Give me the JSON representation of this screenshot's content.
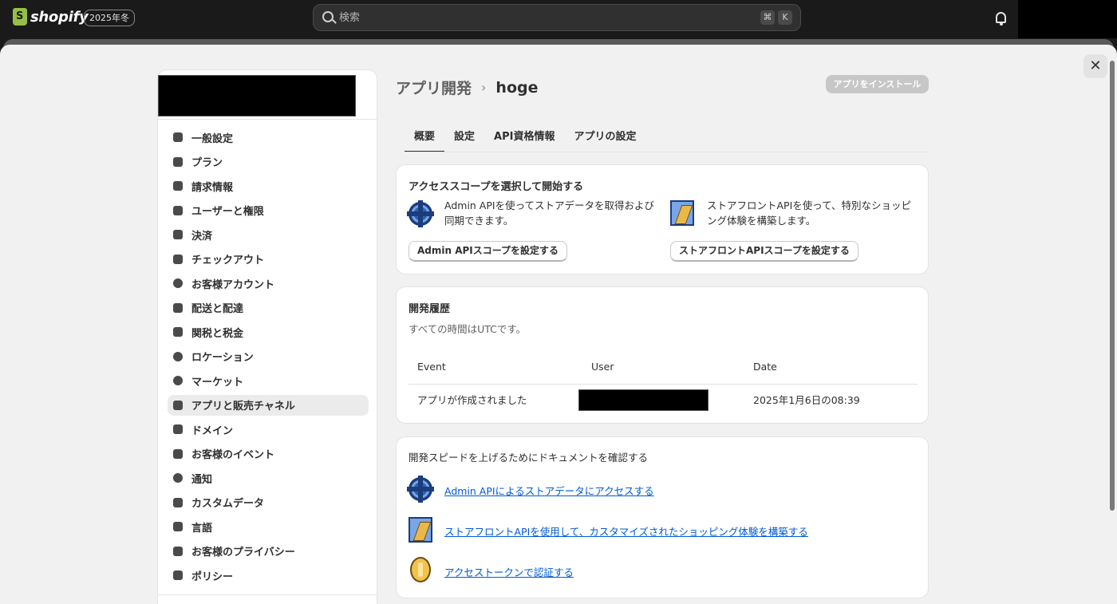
{
  "topbar": {
    "logo_text": "shopify",
    "edition_badge": "2025年冬",
    "search_placeholder": "検索",
    "shortcut_cmd": "⌘",
    "shortcut_key": "K"
  },
  "sidebar": {
    "items": [
      {
        "label": "一般設定",
        "icon": "store-icon"
      },
      {
        "label": "プラン",
        "icon": "plan-icon"
      },
      {
        "label": "請求情報",
        "icon": "receipt-icon"
      },
      {
        "label": "ユーザーと権限",
        "icon": "users-icon"
      },
      {
        "label": "決済",
        "icon": "payments-icon"
      },
      {
        "label": "チェックアウト",
        "icon": "cart-icon"
      },
      {
        "label": "お客様アカウント",
        "icon": "person-icon"
      },
      {
        "label": "配送と配達",
        "icon": "truck-icon"
      },
      {
        "label": "関税と税金",
        "icon": "tax-bag-icon"
      },
      {
        "label": "ロケーション",
        "icon": "location-pin-icon"
      },
      {
        "label": "マーケット",
        "icon": "globe-icon"
      },
      {
        "label": "アプリと販売チャネル",
        "icon": "apps-icon",
        "active": true
      },
      {
        "label": "ドメイン",
        "icon": "domain-icon"
      },
      {
        "label": "お客様のイベント",
        "icon": "cursor-click-icon"
      },
      {
        "label": "通知",
        "icon": "bell-icon"
      },
      {
        "label": "カスタムデータ",
        "icon": "database-icon"
      },
      {
        "label": "言語",
        "icon": "language-icon"
      },
      {
        "label": "お客様のプライバシー",
        "icon": "lock-icon"
      },
      {
        "label": "ポリシー",
        "icon": "policy-icon"
      }
    ]
  },
  "header": {
    "breadcrumb_parent": "アプリ開発",
    "breadcrumb_current": "hoge",
    "install_button": "アプリをインストール"
  },
  "tabs": [
    {
      "label": "概要",
      "active": true
    },
    {
      "label": "設定"
    },
    {
      "label": "API資格情報"
    },
    {
      "label": "アプリの設定"
    }
  ],
  "scope_card": {
    "title": "アクセススコープを選択して開始する",
    "admin_desc_line1": "Admin APIを使ってストアデータを取得および",
    "admin_desc_line2": "同期できます。",
    "admin_button": "Admin APIスコープを設定する",
    "storefront_desc_line1": "ストアフロントAPIを使って、特別なショッピ",
    "storefront_desc_line2": "ング体験を構築します。",
    "storefront_button": "ストアフロントAPIスコープを設定する"
  },
  "history_card": {
    "title": "開発履歴",
    "subtitle": "すべての時間はUTCです。",
    "columns": [
      "Event",
      "User",
      "Date"
    ],
    "rows": [
      {
        "event": "アプリが作成されました",
        "date": "2025年1月6日の08:39"
      }
    ]
  },
  "docs_card": {
    "intro": "開発スピードを上げるためにドキュメントを確認する",
    "links": [
      "Admin APIによるストアデータにアクセスする",
      "ストアフロントAPIを使用して、カスタマイズされたショッピング体験を構築する",
      "アクセストークンで認証する"
    ]
  }
}
